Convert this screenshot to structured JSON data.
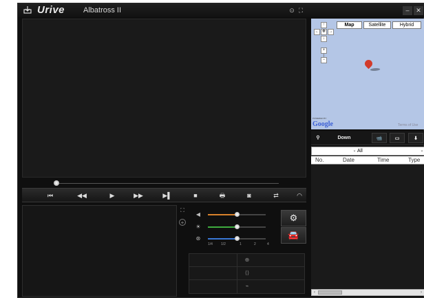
{
  "app": {
    "brand": "Urive",
    "model": "Albatross II",
    "buttons": {
      "settings": "⊙",
      "fullscreen": "⛶",
      "minimize": "–",
      "close": "✕"
    }
  },
  "playback": {
    "buttons": [
      {
        "name": "skip-start-icon",
        "glyph": "⏮"
      },
      {
        "name": "rewind-icon",
        "glyph": "◀◀"
      },
      {
        "name": "play-icon",
        "glyph": "▶"
      },
      {
        "name": "fast-forward-icon",
        "glyph": "▶▶"
      },
      {
        "name": "skip-end-icon",
        "glyph": "▶▌"
      },
      {
        "name": "stop-icon",
        "glyph": "■"
      },
      {
        "name": "print-icon",
        "glyph": "🖶"
      },
      {
        "name": "camera-icon",
        "glyph": "◙"
      },
      {
        "name": "swap-icon",
        "glyph": "⇄"
      },
      {
        "name": "speedometer-icon",
        "glyph": "◠"
      }
    ]
  },
  "sliders": {
    "volume": {
      "icon": "speaker-icon",
      "glyph": "◀",
      "level": 0.5,
      "color": "#d9822b"
    },
    "brightness": {
      "icon": "brightness-icon",
      "glyph": "☀",
      "level": 0.5,
      "color": "#3fae3f"
    },
    "speed": {
      "icon": "speed-icon",
      "glyph": "⊛",
      "level": 0.5,
      "color": "#3a78d6",
      "labels": [
        "1/4",
        "1/2",
        "1",
        "2",
        "4"
      ]
    }
  },
  "side_buttons": {
    "settings": {
      "icon": "gear-icon",
      "glyph": "⚙"
    },
    "car": {
      "icon": "car-icon",
      "glyph": "🚘"
    }
  },
  "grid_icons": [
    {
      "name": "compass-icon",
      "glyph": "⊕"
    },
    {
      "name": "sensor-icon",
      "glyph": "⟨⟩"
    },
    {
      "name": "gps-icon",
      "glyph": "⌁"
    }
  ],
  "map": {
    "tabs": [
      "Map",
      "Satellite",
      "Hybrid"
    ],
    "active_tab": "Map",
    "powered_by": "POWERED BY",
    "logo": "Google",
    "terms": "Terms of Use",
    "controls": {
      "up": "↑",
      "left": "←",
      "center": "✥",
      "right": "→",
      "down": "↓",
      "zoom_in": "+",
      "zoom_out": "−"
    }
  },
  "panel": {
    "tabs": [
      {
        "name": "tab-location",
        "label": "⚲"
      },
      {
        "name": "tab-down",
        "label": "Down"
      },
      {
        "name": "tab-camera",
        "label": "📹"
      },
      {
        "name": "tab-memory",
        "label": "▭"
      },
      {
        "name": "tab-download",
        "label": "⬇"
      }
    ],
    "filter": {
      "selected": "All",
      "drop_glyph": "⌄",
      "chevron": "⌄"
    },
    "columns": [
      "No.",
      "Date",
      "Time",
      "Type"
    ],
    "scroll": {
      "left": "‹",
      "right": "›"
    }
  }
}
